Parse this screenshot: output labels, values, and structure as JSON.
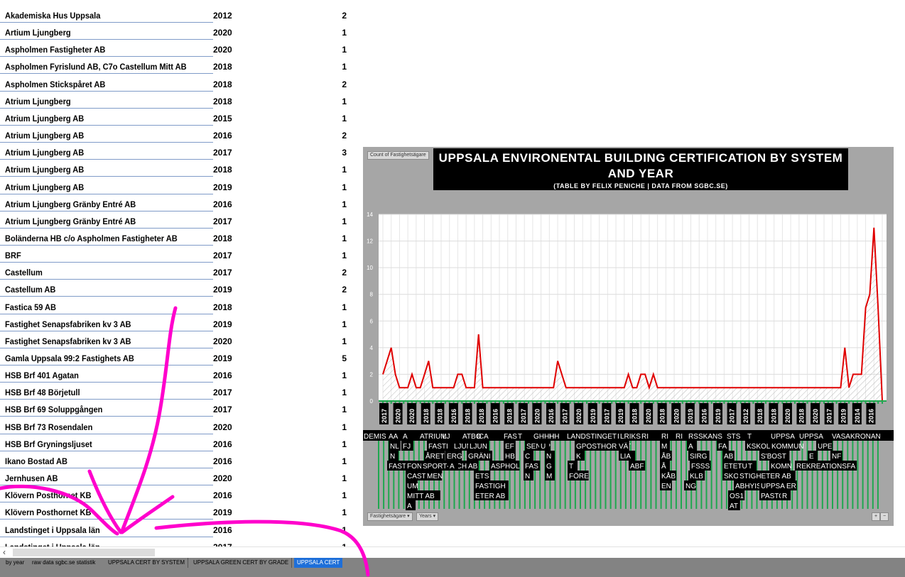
{
  "columns": [
    "Fastighetsägare",
    "Years",
    "Count of Fastighetsägare"
  ],
  "rows": [
    {
      "owner": "Akademiska Hus Uppsala",
      "year": "2012",
      "count": "2"
    },
    {
      "owner": "Artium Ljungberg",
      "year": "2020",
      "count": "1"
    },
    {
      "owner": "Aspholmen Fastigheter AB",
      "year": "2020",
      "count": "1"
    },
    {
      "owner": "Aspholmen Fyrislund AB, C7o Castellum Mitt AB",
      "year": "2018",
      "count": "1"
    },
    {
      "owner": "Aspholmen Stickspåret AB",
      "year": "2018",
      "count": "2"
    },
    {
      "owner": "Atrium Ljungberg",
      "year": "2018",
      "count": "1"
    },
    {
      "owner": "Atrium Ljungberg AB",
      "year": "2015",
      "count": "1"
    },
    {
      "owner": "Atrium Ljungberg AB",
      "year": "2016",
      "count": "2"
    },
    {
      "owner": "Atrium Ljungberg AB",
      "year": "2017",
      "count": "3"
    },
    {
      "owner": "Atrium Ljungberg AB",
      "year": "2018",
      "count": "1"
    },
    {
      "owner": "Atrium Ljungberg AB",
      "year": "2019",
      "count": "1"
    },
    {
      "owner": "Atrium Ljungberg Gränby Entré AB",
      "year": "2016",
      "count": "1"
    },
    {
      "owner": "Atrium Ljungberg Gränby Entré AB",
      "year": "2017",
      "count": "1"
    },
    {
      "owner": "Boländerna HB c/o Aspholmen Fastigheter AB",
      "year": "2018",
      "count": "1"
    },
    {
      "owner": "BRF",
      "year": "2017",
      "count": "1"
    },
    {
      "owner": "Castellum",
      "year": "2017",
      "count": "2"
    },
    {
      "owner": "Castellum AB",
      "year": "2019",
      "count": "2"
    },
    {
      "owner": "Fastica 59 AB",
      "year": "2018",
      "count": "1"
    },
    {
      "owner": "Fastighet Senapsfabriken kv 3 AB",
      "year": "2019",
      "count": "1"
    },
    {
      "owner": "Fastighet Senapsfabriken kv 3 AB",
      "year": "2020",
      "count": "1"
    },
    {
      "owner": "Gamla Uppsala 99:2 Fastighets AB",
      "year": "2019",
      "count": "5"
    },
    {
      "owner": "HSB Brf 401 Agatan",
      "year": "2016",
      "count": "1"
    },
    {
      "owner": "HSB Brf 48 Börjetull",
      "year": "2017",
      "count": "1"
    },
    {
      "owner": "HSB Brf 69 Soluppgången",
      "year": "2017",
      "count": "1"
    },
    {
      "owner": "HSB Brf 73 Rosendalen",
      "year": "2020",
      "count": "1"
    },
    {
      "owner": "HSB Brf Gryningsljuset",
      "year": "2016",
      "count": "1"
    },
    {
      "owner": "Ikano Bostad AB",
      "year": "2016",
      "count": "1"
    },
    {
      "owner": "Jernhusen AB",
      "year": "2020",
      "count": "1"
    },
    {
      "owner": "Klövern Posthornet KB",
      "year": "2016",
      "count": "1"
    },
    {
      "owner": "Klövern Posthornet KB",
      "year": "2019",
      "count": "1"
    },
    {
      "owner": "Landstinget i Uppsala län",
      "year": "2016",
      "count": "1"
    },
    {
      "owner": "Landstinget i Uppsala län",
      "year": "2017",
      "count": "1"
    }
  ],
  "tabs": [
    {
      "label": "by year"
    },
    {
      "label": "raw data sgbc.se statistik"
    },
    {
      "label": "UPPSALA CERT BY SYSTEM"
    },
    {
      "label": "UPPSALA GREEN CERT BY GRADE"
    },
    {
      "label": "UPPSALA CERT"
    }
  ],
  "chart": {
    "field_button": "Count of Fastighetsägare",
    "title": "UPPSALA ENVIRONENTAL BUILDING CERTIFICATION BY SYSTEM AND YEAR",
    "subtitle": "(TABLE BY FELIX PENICHE | DATA FROM SGBC.SE)",
    "axis_buttons": [
      "Fastighetsägare",
      "Years"
    ],
    "zoom_buttons": [
      "+",
      "−"
    ],
    "colors": {
      "line": "#e00000",
      "background": "#a6a6a6",
      "plot": "#ffffff",
      "title_bg": "#000000",
      "annotation": "#ff00cc",
      "axis_bars": "#1fa84f"
    }
  },
  "chart_data": {
    "type": "area",
    "ylim": [
      0,
      14
    ],
    "yticks": [
      0,
      2,
      4,
      6,
      8,
      10,
      12,
      14
    ],
    "x_labels": [
      "2017",
      "2020",
      "2020",
      "2018",
      "2018",
      "2016",
      "2018",
      "2018",
      "2016",
      "2018",
      "2017",
      "2020",
      "2016",
      "2017",
      "2020",
      "2019",
      "2017",
      "2019",
      "2018",
      "2020",
      "2018",
      "2020",
      "2019",
      "2016",
      "2019",
      "2017",
      "2012",
      "2018",
      "2018",
      "2020",
      "2018",
      "2020",
      "2017",
      "2019",
      "2014",
      "2016"
    ],
    "group_labels_visible": [
      "DEMIS",
      "AA",
      "A",
      "ATRIUM",
      "LJ",
      "ATBO",
      "ICA",
      "FAS",
      "T",
      "GHHH",
      "HH",
      "LANDSTINGET",
      "I",
      "LRIKS",
      "RI",
      "RI",
      "RI",
      "RS",
      "SKANS",
      "STS",
      "T",
      "UPPSA",
      "UPPSA",
      "VASAKRONAN",
      "NL",
      "FJ",
      "FASTI",
      "LJUNGB",
      "LJUN",
      "EF",
      "SENAP",
      "U",
      "GPOSTHORNET",
      "VÄ",
      "LIA",
      "M",
      "A",
      "FA",
      "KSKOLFAS",
      "KOMMUN",
      "UPE",
      "N",
      "ÅRET",
      "ERG",
      "GRÄNI",
      "HB",
      "C",
      "N",
      "K",
      "ÅB",
      "SIRG",
      "AB",
      "S'BOST",
      "E",
      "NF",
      "FASTIPET",
      "FON",
      "SPORT- OCH",
      "A",
      "AB",
      "ASPHOL",
      "FAS",
      "G",
      "T",
      "ABF",
      "Å",
      "FSSS",
      "ETETU",
      "T",
      "KOMN",
      "REKREATIONSFA",
      "CASTELL",
      "MEN",
      "ETS",
      "N",
      "M",
      "FÖRE",
      "KÅB",
      "KLB",
      "SKOL",
      "STIGHETER AB",
      "UM",
      "FASTIGH",
      "EN",
      "NG",
      "ABHYISF",
      "UPPSA",
      "ER",
      "MITT AB",
      "ETER AB",
      "OS1",
      "PASTO",
      "R",
      "A",
      "AT"
    ],
    "values": [
      2,
      3,
      4,
      2,
      1,
      1,
      1,
      2,
      1,
      1,
      2,
      3,
      1,
      1,
      1,
      1,
      1,
      1,
      2,
      2,
      1,
      1,
      1,
      5,
      1,
      1,
      1,
      1,
      1,
      1,
      1,
      1,
      1,
      1,
      1,
      1,
      1,
      1,
      1,
      1,
      1,
      1,
      3,
      2,
      1,
      1,
      1,
      1,
      1,
      1,
      1,
      1,
      1,
      1,
      1,
      1,
      1,
      1,
      1,
      2,
      1,
      1,
      2,
      2,
      1,
      2,
      1,
      1,
      1,
      1,
      1,
      1,
      1,
      1,
      1,
      1,
      1,
      1,
      1,
      1,
      1,
      1,
      1,
      1,
      1,
      1,
      1,
      1,
      1,
      1,
      1,
      1,
      1,
      1,
      1,
      1,
      1,
      1,
      1,
      1,
      1,
      1,
      1,
      1,
      1,
      1,
      1,
      1,
      1,
      1,
      1,
      4,
      1,
      2,
      2,
      2,
      7,
      8,
      13,
      7,
      0
    ]
  }
}
